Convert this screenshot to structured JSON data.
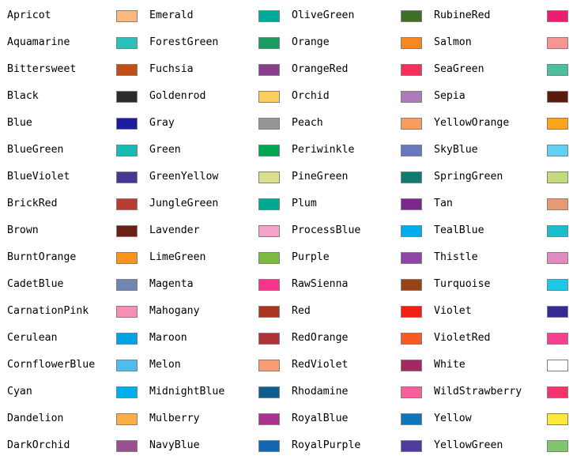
{
  "chart_data": {
    "type": "table",
    "title": "",
    "xlabel": "",
    "ylabel": "",
    "layout": {
      "columns": 4,
      "rows": 17,
      "order": "column-major",
      "cell_format": "name-then-swatch",
      "swatch_border_color": "#808080",
      "background": "#ffffff",
      "text_color": "#000000"
    },
    "categories": [
      "Apricot",
      "Aquamarine",
      "Bittersweet",
      "Black",
      "Blue",
      "BlueGreen",
      "BlueViolet",
      "BrickRed",
      "Brown",
      "BurntOrange",
      "CadetBlue",
      "CarnationPink",
      "Cerulean",
      "CornflowerBlue",
      "Cyan",
      "Dandelion",
      "DarkOrchid",
      "Emerald",
      "ForestGreen",
      "Fuchsia",
      "Goldenrod",
      "Gray",
      "Green",
      "GreenYellow",
      "JungleGreen",
      "Lavender",
      "LimeGreen",
      "Magenta",
      "Mahogany",
      "Maroon",
      "Melon",
      "MidnightBlue",
      "Mulberry",
      "NavyBlue",
      "OliveGreen",
      "Orange",
      "OrangeRed",
      "Orchid",
      "Peach",
      "Periwinkle",
      "PineGreen",
      "Plum",
      "ProcessBlue",
      "Purple",
      "RawSienna",
      "Red",
      "RedOrange",
      "RedViolet",
      "Rhodamine",
      "RoyalBlue",
      "RoyalPurple",
      "RubineRed",
      "Salmon",
      "SeaGreen",
      "Sepia",
      "YellowOrange",
      "SkyBlue",
      "SpringGreen",
      "Tan",
      "TealBlue",
      "Thistle",
      "Turquoise",
      "Violet",
      "VioletRed",
      "White",
      "WildStrawberry",
      "Yellow",
      "YellowGreen"
    ],
    "values": [
      "#FBB982",
      "#2DBFBA",
      "#C04F17",
      "#2B2C2D",
      "#1B1C9C",
      "#17BBB4",
      "#473793",
      "#B63E31",
      "#682017",
      "#F7941E",
      "#6F87B2",
      "#F68FB4",
      "#00A2E0",
      "#4FBDE9",
      "#00AEEF",
      "#F9AE47",
      "#9A4F91",
      "#FBB982",
      "#1D9A62",
      "#8A3C8F",
      "#FBCE5C",
      "#969696",
      "#00A64F",
      "#DCE08E",
      "#00A991",
      "#F4A4C8",
      "#7CBB42",
      "#F6358A",
      "#A9341F",
      "#AF3235",
      "#F89C78",
      "#0D5E8C",
      "#A9328E",
      "#1267B0",
      "#3D7024",
      "#F6881F",
      "#F4315B",
      "#AD7BB9",
      "#F89D61",
      "#6878BE",
      "#107B71",
      "#7A288A",
      "#00AEEF",
      "#8C46A4",
      "#964318",
      "#F02015",
      "#F75A25",
      "#A12A62",
      "#F7619B",
      "#0E77BC",
      "#503A9A",
      "#ED1D6F",
      "#F79592",
      "#4FBE9E",
      "#5B1B0B",
      "#FAA41A",
      "#62D0F2",
      "#C4DB7D",
      "#E59B72",
      "#19BECE",
      "#E18CC0",
      "#20C6E5",
      "#352A93",
      "#F5418F",
      "#FFFFFF",
      "#F4336C",
      "#FDE93E",
      "#82C570"
    ],
    "entries": [
      {
        "name": "Apricot",
        "color": "#FBB982"
      },
      {
        "name": "Aquamarine",
        "color": "#2DBFBA"
      },
      {
        "name": "Bittersweet",
        "color": "#C04F17"
      },
      {
        "name": "Black",
        "color": "#2B2C2D"
      },
      {
        "name": "Blue",
        "color": "#1B1C9C"
      },
      {
        "name": "BlueGreen",
        "color": "#17BBB4"
      },
      {
        "name": "BlueViolet",
        "color": "#473793"
      },
      {
        "name": "BrickRed",
        "color": "#B63E31"
      },
      {
        "name": "Brown",
        "color": "#682017"
      },
      {
        "name": "BurntOrange",
        "color": "#F7941E"
      },
      {
        "name": "CadetBlue",
        "color": "#6F87B2"
      },
      {
        "name": "CarnationPink",
        "color": "#F68FB4"
      },
      {
        "name": "Cerulean",
        "color": "#00A2E0"
      },
      {
        "name": "CornflowerBlue",
        "color": "#4FBDE9"
      },
      {
        "name": "Cyan",
        "color": "#00AEEF"
      },
      {
        "name": "Dandelion",
        "color": "#F9AE47"
      },
      {
        "name": "DarkOrchid",
        "color": "#9A4F91"
      },
      {
        "name": "Emerald",
        "color": "#00A99D"
      },
      {
        "name": "ForestGreen",
        "color": "#1D9A62"
      },
      {
        "name": "Fuchsia",
        "color": "#8A3C8F"
      },
      {
        "name": "Goldenrod",
        "color": "#FBCE5C"
      },
      {
        "name": "Gray",
        "color": "#969696"
      },
      {
        "name": "Green",
        "color": "#00A64F"
      },
      {
        "name": "GreenYellow",
        "color": "#DCE08E"
      },
      {
        "name": "JungleGreen",
        "color": "#00A991"
      },
      {
        "name": "Lavender",
        "color": "#F4A4C8"
      },
      {
        "name": "LimeGreen",
        "color": "#7CBB42"
      },
      {
        "name": "Magenta",
        "color": "#F6358A"
      },
      {
        "name": "Mahogany",
        "color": "#A9341F"
      },
      {
        "name": "Maroon",
        "color": "#AF3235"
      },
      {
        "name": "Melon",
        "color": "#F89C78"
      },
      {
        "name": "MidnightBlue",
        "color": "#0D5E8C"
      },
      {
        "name": "Mulberry",
        "color": "#A9328E"
      },
      {
        "name": "NavyBlue",
        "color": "#1267B0"
      },
      {
        "name": "OliveGreen",
        "color": "#3D7024"
      },
      {
        "name": "Orange",
        "color": "#F6881F"
      },
      {
        "name": "OrangeRed",
        "color": "#F4315B"
      },
      {
        "name": "Orchid",
        "color": "#AD7BB9"
      },
      {
        "name": "Peach",
        "color": "#F89D61"
      },
      {
        "name": "Periwinkle",
        "color": "#6878BE"
      },
      {
        "name": "PineGreen",
        "color": "#107B71"
      },
      {
        "name": "Plum",
        "color": "#7A288A"
      },
      {
        "name": "ProcessBlue",
        "color": "#00AEEF"
      },
      {
        "name": "Purple",
        "color": "#8C46A4"
      },
      {
        "name": "RawSienna",
        "color": "#964318"
      },
      {
        "name": "Red",
        "color": "#F02015"
      },
      {
        "name": "RedOrange",
        "color": "#F75A25"
      },
      {
        "name": "RedViolet",
        "color": "#A12A62"
      },
      {
        "name": "Rhodamine",
        "color": "#F7619B"
      },
      {
        "name": "RoyalBlue",
        "color": "#0E77BC"
      },
      {
        "name": "RoyalPurple",
        "color": "#503A9A"
      },
      {
        "name": "RubineRed",
        "color": "#ED1D6F"
      },
      {
        "name": "Salmon",
        "color": "#F79592"
      },
      {
        "name": "SeaGreen",
        "color": "#4FBE9E"
      },
      {
        "name": "Sepia",
        "color": "#5B1B0B"
      },
      {
        "name": "YellowOrange",
        "color": "#FAA41A"
      },
      {
        "name": "SkyBlue",
        "color": "#62D0F2"
      },
      {
        "name": "SpringGreen",
        "color": "#C4DB7D"
      },
      {
        "name": "Tan",
        "color": "#E59B72"
      },
      {
        "name": "TealBlue",
        "color": "#19BECE"
      },
      {
        "name": "Thistle",
        "color": "#E18CC0"
      },
      {
        "name": "Turquoise",
        "color": "#20C6E5"
      },
      {
        "name": "Violet",
        "color": "#352A93"
      },
      {
        "name": "VioletRed",
        "color": "#F5418F"
      },
      {
        "name": "White",
        "color": "#FFFFFF"
      },
      {
        "name": "WildStrawberry",
        "color": "#F4336C"
      },
      {
        "name": "Yellow",
        "color": "#FDE93E"
      },
      {
        "name": "YellowGreen",
        "color": "#82C570"
      }
    ],
    "columns": [
      [
        {
          "name": "Apricot",
          "color": "#FBB982"
        },
        {
          "name": "Aquamarine",
          "color": "#2DBFBA"
        },
        {
          "name": "Bittersweet",
          "color": "#C04F17"
        },
        {
          "name": "Black",
          "color": "#2B2C2D"
        },
        {
          "name": "Blue",
          "color": "#1B1C9C"
        },
        {
          "name": "BlueGreen",
          "color": "#17BBB4"
        },
        {
          "name": "BlueViolet",
          "color": "#473793"
        },
        {
          "name": "BrickRed",
          "color": "#B63E31"
        },
        {
          "name": "Brown",
          "color": "#682017"
        },
        {
          "name": "BurntOrange",
          "color": "#F7941E"
        },
        {
          "name": "CadetBlue",
          "color": "#6F87B2"
        },
        {
          "name": "CarnationPink",
          "color": "#F68FB4"
        },
        {
          "name": "Cerulean",
          "color": "#00A2E0"
        },
        {
          "name": "CornflowerBlue",
          "color": "#4FBDE9"
        },
        {
          "name": "Cyan",
          "color": "#00AEEF"
        },
        {
          "name": "Dandelion",
          "color": "#F9AE47"
        },
        {
          "name": "DarkOrchid",
          "color": "#9A4F91"
        }
      ],
      [
        {
          "name": "Emerald",
          "color": "#00A99D"
        },
        {
          "name": "ForestGreen",
          "color": "#1D9A62"
        },
        {
          "name": "Fuchsia",
          "color": "#8A3C8F"
        },
        {
          "name": "Goldenrod",
          "color": "#FBCE5C"
        },
        {
          "name": "Gray",
          "color": "#969696"
        },
        {
          "name": "Green",
          "color": "#00A64F"
        },
        {
          "name": "GreenYellow",
          "color": "#DCE08E"
        },
        {
          "name": "JungleGreen",
          "color": "#00A991"
        },
        {
          "name": "Lavender",
          "color": "#F4A4C8"
        },
        {
          "name": "LimeGreen",
          "color": "#7CBB42"
        },
        {
          "name": "Magenta",
          "color": "#F6358A"
        },
        {
          "name": "Mahogany",
          "color": "#A9341F"
        },
        {
          "name": "Maroon",
          "color": "#AF3235"
        },
        {
          "name": "Melon",
          "color": "#F89C78"
        },
        {
          "name": "MidnightBlue",
          "color": "#0D5E8C"
        },
        {
          "name": "Mulberry",
          "color": "#A9328E"
        },
        {
          "name": "NavyBlue",
          "color": "#1267B0"
        }
      ],
      [
        {
          "name": "OliveGreen",
          "color": "#3D7024"
        },
        {
          "name": "Orange",
          "color": "#F6881F"
        },
        {
          "name": "OrangeRed",
          "color": "#F4315B"
        },
        {
          "name": "Orchid",
          "color": "#AD7BB9"
        },
        {
          "name": "Peach",
          "color": "#F89D61"
        },
        {
          "name": "Periwinkle",
          "color": "#6878BE"
        },
        {
          "name": "PineGreen",
          "color": "#107B71"
        },
        {
          "name": "Plum",
          "color": "#7A288A"
        },
        {
          "name": "ProcessBlue",
          "color": "#00AEEF"
        },
        {
          "name": "Purple",
          "color": "#8C46A4"
        },
        {
          "name": "RawSienna",
          "color": "#964318"
        },
        {
          "name": "Red",
          "color": "#F02015"
        },
        {
          "name": "RedOrange",
          "color": "#F75A25"
        },
        {
          "name": "RedViolet",
          "color": "#A12A62"
        },
        {
          "name": "Rhodamine",
          "color": "#F7619B"
        },
        {
          "name": "RoyalBlue",
          "color": "#0E77BC"
        },
        {
          "name": "RoyalPurple",
          "color": "#503A9A"
        }
      ],
      [
        {
          "name": "RubineRed",
          "color": "#ED1D6F"
        },
        {
          "name": "Salmon",
          "color": "#F79592"
        },
        {
          "name": "SeaGreen",
          "color": "#4FBE9E"
        },
        {
          "name": "Sepia",
          "color": "#5B1B0B"
        },
        {
          "name": "YellowOrange",
          "color": "#FAA41A"
        },
        {
          "name": "SkyBlue",
          "color": "#62D0F2"
        },
        {
          "name": "SpringGreen",
          "color": "#C4DB7D"
        },
        {
          "name": "Tan",
          "color": "#E59B72"
        },
        {
          "name": "TealBlue",
          "color": "#19BECE"
        },
        {
          "name": "Thistle",
          "color": "#E18CC0"
        },
        {
          "name": "Turquoise",
          "color": "#20C6E5"
        },
        {
          "name": "Violet",
          "color": "#352A93"
        },
        {
          "name": "VioletRed",
          "color": "#F5418F"
        },
        {
          "name": "White",
          "color": "#FFFFFF"
        },
        {
          "name": "WildStrawberry",
          "color": "#F4336C"
        },
        {
          "name": "Yellow",
          "color": "#FDE93E"
        },
        {
          "name": "YellowGreen",
          "color": "#82C570"
        }
      ]
    ]
  }
}
